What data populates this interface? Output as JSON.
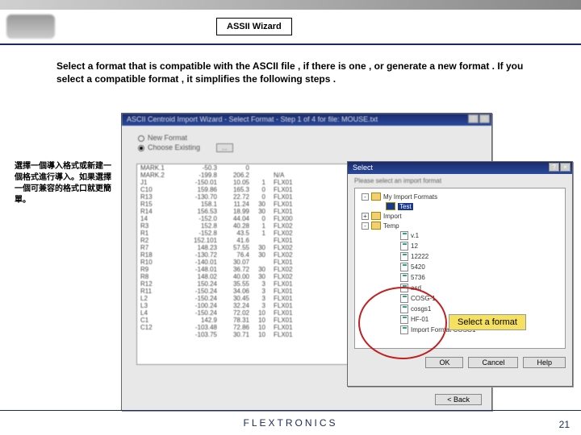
{
  "header": {
    "tab_label": "ASSII Wizard"
  },
  "description": "Select a format that is compatible with the ASCII file , if there is one , or generate a new format . If you select a compatible format , it simplifies the following steps .",
  "side_note": "選擇一個導入格式或新建一個格式進行導入。如果選擇一個可兼容的格式口就更簡單。",
  "wizard": {
    "title": "ASCII Centroid Import Wizard - Select Format - Step 1 of 4 for file: MOUSE.txt",
    "radio_new": "New Format",
    "radio_existing": "Choose Existing",
    "dots": "...",
    "rows": [
      [
        "MARK.1",
        "-50.3",
        "0",
        ""
      ],
      [
        "MARK.2",
        "-199.8",
        "206.2",
        "",
        "N/A"
      ],
      [
        "J1",
        "-150.01",
        "10.05",
        "1",
        "FLX01"
      ],
      [
        "C10",
        "159.86",
        "165.3",
        "0",
        "FLX01"
      ],
      [
        "R13",
        "-130.70",
        "22.72",
        "0",
        "FLX01"
      ],
      [
        "R15",
        "158.1",
        "11.24",
        "30",
        "FLX01"
      ],
      [
        "R14",
        "156.53",
        "18.99",
        "30",
        "FLX01"
      ],
      [
        "14",
        "-152.0",
        "44.04",
        "0",
        "FLX00"
      ],
      [
        "R3",
        "152.8",
        "40.28",
        "1",
        "FLX02"
      ],
      [
        "R1",
        "-152.8",
        "43.5",
        "1",
        "FLX02"
      ],
      [
        "R2",
        "152.101",
        "41.6",
        "",
        "FLX01"
      ],
      [
        "R7",
        "148.23",
        "57.55",
        "30",
        "FLX02"
      ],
      [
        "R18",
        "-130.72",
        "76.4",
        "30",
        "FLX02"
      ],
      [
        "R10",
        "-140.01",
        "30.07",
        "",
        "FLX01"
      ],
      [
        "R9",
        "-148.01",
        "36.72",
        "30",
        "FLX02"
      ],
      [
        "R8",
        "148.02",
        "40.00",
        "30",
        "FLX02"
      ],
      [
        "R12",
        "150.24",
        "35.55",
        "3",
        "FLX01"
      ],
      [
        "R11",
        "-150.24",
        "34.06",
        "3",
        "FLX01"
      ],
      [
        "L2",
        "-150.24",
        "30.45",
        "3",
        "FLX01"
      ],
      [
        "L3",
        "-100.24",
        "32.24",
        "3",
        "FLX01"
      ],
      [
        "L4",
        "-150.24",
        "72.02",
        "10",
        "FLX01"
      ],
      [
        "C1",
        "142.9",
        "78.31",
        "10",
        "FLX01"
      ],
      [
        "C12",
        "-103.48",
        "72.86",
        "10",
        "FLX01"
      ],
      [
        "",
        "-103.75",
        "30.71",
        "10",
        "FLX01"
      ]
    ],
    "back_btn": "< Back"
  },
  "select_dialog": {
    "title": "Select",
    "hint": "Please select an import format",
    "tree": {
      "root1": "My Import Formats",
      "root1_child": "Test",
      "root2": "Import",
      "root3": "Temp",
      "files": [
        "v.1",
        "12",
        "12222",
        "5420",
        "5736",
        "asd",
        "COSG-1",
        "cosgs1",
        "HF-01",
        "Import Format COSG1"
      ]
    },
    "ok": "OK",
    "cancel": "Cancel",
    "help": "Help"
  },
  "callout": "Select  a format",
  "footer": {
    "logo": "FLEXTRONICS",
    "page": "21"
  }
}
